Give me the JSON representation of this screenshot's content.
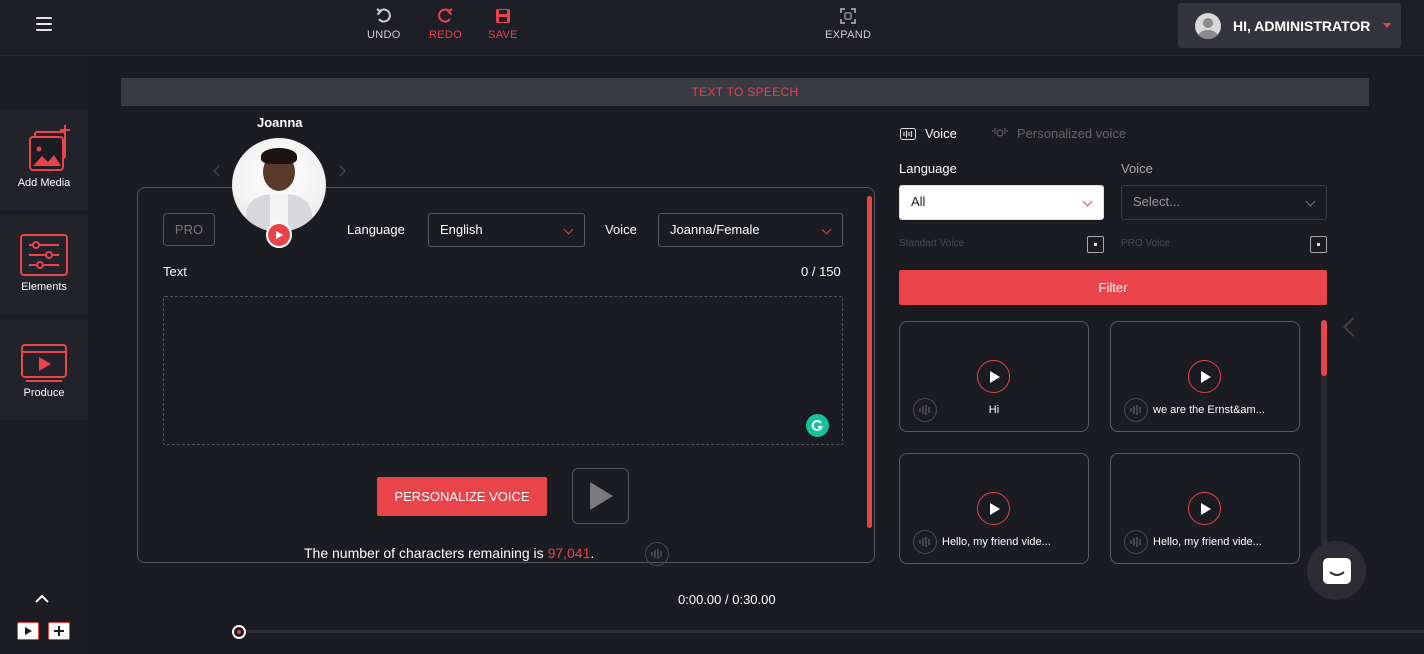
{
  "topbar": {
    "undo_label": "UNDO",
    "redo_label": "REDO",
    "save_label": "SAVE",
    "expand_label": "EXPAND",
    "user_label": "HI, ADMINISTRATOR"
  },
  "sidebar": {
    "items": [
      {
        "label": "Add Media",
        "icon": "add-media-icon"
      },
      {
        "label": "Elements",
        "icon": "sliders-icon"
      },
      {
        "label": "Produce",
        "icon": "video-play-icon"
      }
    ]
  },
  "banner": {
    "title": "TEXT TO SPEECH"
  },
  "editor": {
    "avatar_name": "Joanna",
    "pro_label": "PRO",
    "language_label": "Language",
    "language_value": "English",
    "voice_label": "Voice",
    "voice_value": "Joanna/Female",
    "text_label": "Text",
    "char_count": "0 / 150",
    "personalize_button": "PERSONALIZE VOICE",
    "remaining_prefix": "The number of characters remaining is ",
    "remaining_value": "97,041",
    "remaining_suffix": "."
  },
  "right_panel": {
    "tabs": [
      {
        "label": "Voice",
        "active": true
      },
      {
        "label": "Personalized voice",
        "active": false
      }
    ],
    "language_label": "Language",
    "language_value": "All",
    "voice_label": "Voice",
    "voice_placeholder": "Select...",
    "standart_voice_label": "Standart Voice",
    "pro_voice_label": "PRO Voice",
    "filter_button": "Filter",
    "voice_cards": [
      {
        "caption": "Hi"
      },
      {
        "caption": "we are the Ernst&am..."
      },
      {
        "caption": "Hello, my friend vide..."
      },
      {
        "caption": "Hello, my friend vide..."
      }
    ]
  },
  "timeline": {
    "current": "0:00.00 /",
    "total": "0:30.00"
  },
  "colors": {
    "accent": "#e8444a",
    "background": "#1b1b22",
    "banner": "#3a3a45"
  }
}
